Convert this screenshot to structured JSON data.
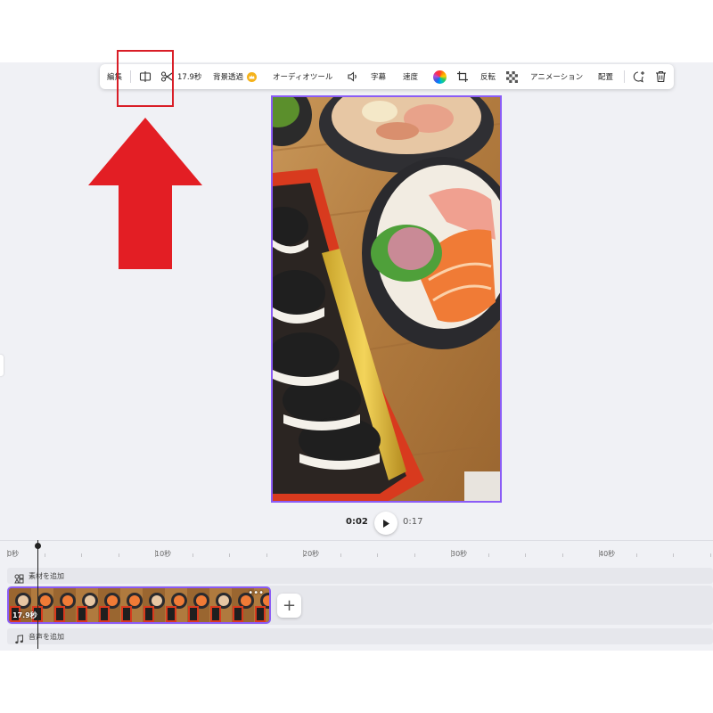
{
  "toolbar": {
    "edit_label": "編集",
    "duration_label": "17.9秒",
    "bg_remove_label": "背景透過",
    "audio_tools_label": "オーディオツール",
    "captions_label": "字幕",
    "speed_label": "速度",
    "flip_label": "反転",
    "animation_label": "アニメーション",
    "position_label": "配置"
  },
  "icons": {
    "split": "split-icon",
    "scissors": "scissors-icon",
    "crown": "crown-icon",
    "volume": "volume-icon",
    "color": "color-wheel-icon",
    "crop": "crop-icon",
    "transparency": "transparency-icon",
    "comment": "comment-add-icon",
    "trash": "trash-icon"
  },
  "colors": {
    "accent": "#8b5cf6",
    "annotation_red": "#d91e27",
    "crown_gold": "#f5b21a"
  },
  "playback": {
    "current_time": "0:02",
    "total_time": "0:17"
  },
  "timeline": {
    "ticks": [
      "0秒",
      "10秒",
      "20秒",
      "30秒",
      "40秒"
    ],
    "add_elements_label": "素材を追加",
    "add_audio_label": "音声を追加",
    "clip_duration": "17.9秒",
    "clip_more": "•••",
    "add_clip": "+"
  }
}
